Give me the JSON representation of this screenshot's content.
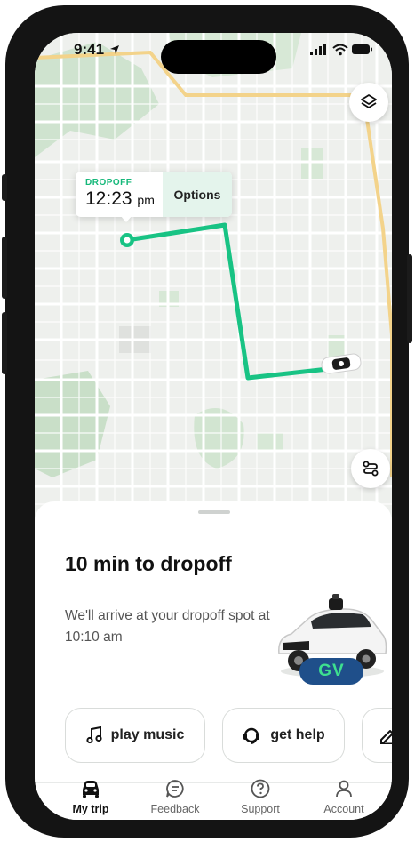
{
  "status_bar": {
    "time": "9:41"
  },
  "map": {
    "callout": {
      "label": "DROPOFF",
      "eta_time": "12:23",
      "eta_unit": "pm",
      "options_label": "Options"
    },
    "layers_icon": "layers-icon",
    "route_options_icon": "route-options-icon",
    "route_color": "#18c384"
  },
  "sheet": {
    "title": "10 min to dropoff",
    "subtitle": "We'll arrive at your dropoff spot at 10:10 am",
    "car_plate": "GV",
    "actions": [
      {
        "label": "play music",
        "icon": "music-note-icon"
      },
      {
        "label": "get help",
        "icon": "help-headset-icon"
      },
      {
        "label": "",
        "icon": "edit-pencil-icon"
      }
    ]
  },
  "tabs": [
    {
      "label": "My trip",
      "icon": "car-icon",
      "active": true
    },
    {
      "label": "Feedback",
      "icon": "feedback-icon",
      "active": false
    },
    {
      "label": "Support",
      "icon": "support-icon",
      "active": false
    },
    {
      "label": "Account",
      "icon": "account-icon",
      "active": false
    }
  ],
  "colors": {
    "accent": "#18c384",
    "plate_badge": "#1f4f8a",
    "plate_text": "#3ee08f"
  }
}
